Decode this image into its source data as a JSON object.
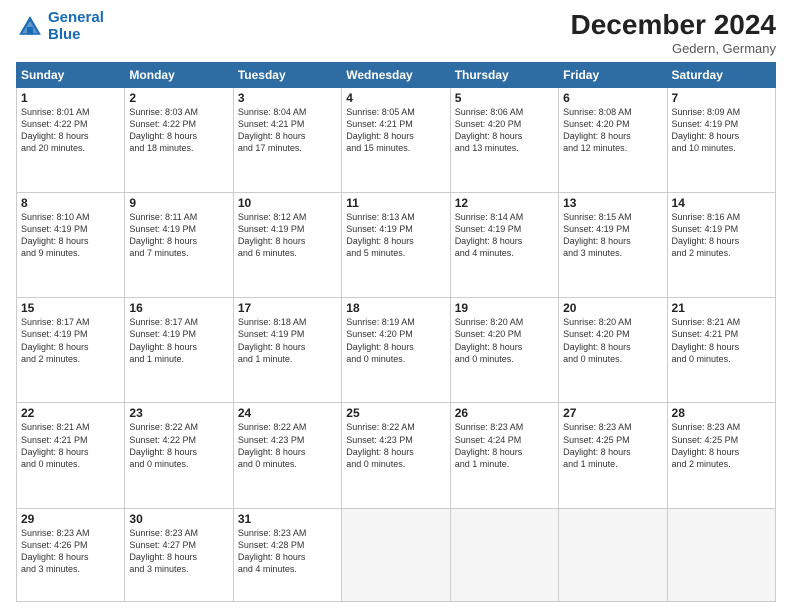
{
  "header": {
    "logo_line1": "General",
    "logo_line2": "Blue",
    "month": "December 2024",
    "location": "Gedern, Germany"
  },
  "weekdays": [
    "Sunday",
    "Monday",
    "Tuesday",
    "Wednesday",
    "Thursday",
    "Friday",
    "Saturday"
  ],
  "weeks": [
    [
      {
        "day": "1",
        "text": "Sunrise: 8:01 AM\nSunset: 4:22 PM\nDaylight: 8 hours\nand 20 minutes."
      },
      {
        "day": "2",
        "text": "Sunrise: 8:03 AM\nSunset: 4:22 PM\nDaylight: 8 hours\nand 18 minutes."
      },
      {
        "day": "3",
        "text": "Sunrise: 8:04 AM\nSunset: 4:21 PM\nDaylight: 8 hours\nand 17 minutes."
      },
      {
        "day": "4",
        "text": "Sunrise: 8:05 AM\nSunset: 4:21 PM\nDaylight: 8 hours\nand 15 minutes."
      },
      {
        "day": "5",
        "text": "Sunrise: 8:06 AM\nSunset: 4:20 PM\nDaylight: 8 hours\nand 13 minutes."
      },
      {
        "day": "6",
        "text": "Sunrise: 8:08 AM\nSunset: 4:20 PM\nDaylight: 8 hours\nand 12 minutes."
      },
      {
        "day": "7",
        "text": "Sunrise: 8:09 AM\nSunset: 4:19 PM\nDaylight: 8 hours\nand 10 minutes."
      }
    ],
    [
      {
        "day": "8",
        "text": "Sunrise: 8:10 AM\nSunset: 4:19 PM\nDaylight: 8 hours\nand 9 minutes."
      },
      {
        "day": "9",
        "text": "Sunrise: 8:11 AM\nSunset: 4:19 PM\nDaylight: 8 hours\nand 7 minutes."
      },
      {
        "day": "10",
        "text": "Sunrise: 8:12 AM\nSunset: 4:19 PM\nDaylight: 8 hours\nand 6 minutes."
      },
      {
        "day": "11",
        "text": "Sunrise: 8:13 AM\nSunset: 4:19 PM\nDaylight: 8 hours\nand 5 minutes."
      },
      {
        "day": "12",
        "text": "Sunrise: 8:14 AM\nSunset: 4:19 PM\nDaylight: 8 hours\nand 4 minutes."
      },
      {
        "day": "13",
        "text": "Sunrise: 8:15 AM\nSunset: 4:19 PM\nDaylight: 8 hours\nand 3 minutes."
      },
      {
        "day": "14",
        "text": "Sunrise: 8:16 AM\nSunset: 4:19 PM\nDaylight: 8 hours\nand 2 minutes."
      }
    ],
    [
      {
        "day": "15",
        "text": "Sunrise: 8:17 AM\nSunset: 4:19 PM\nDaylight: 8 hours\nand 2 minutes."
      },
      {
        "day": "16",
        "text": "Sunrise: 8:17 AM\nSunset: 4:19 PM\nDaylight: 8 hours\nand 1 minute."
      },
      {
        "day": "17",
        "text": "Sunrise: 8:18 AM\nSunset: 4:19 PM\nDaylight: 8 hours\nand 1 minute."
      },
      {
        "day": "18",
        "text": "Sunrise: 8:19 AM\nSunset: 4:20 PM\nDaylight: 8 hours\nand 0 minutes."
      },
      {
        "day": "19",
        "text": "Sunrise: 8:20 AM\nSunset: 4:20 PM\nDaylight: 8 hours\nand 0 minutes."
      },
      {
        "day": "20",
        "text": "Sunrise: 8:20 AM\nSunset: 4:20 PM\nDaylight: 8 hours\nand 0 minutes."
      },
      {
        "day": "21",
        "text": "Sunrise: 8:21 AM\nSunset: 4:21 PM\nDaylight: 8 hours\nand 0 minutes."
      }
    ],
    [
      {
        "day": "22",
        "text": "Sunrise: 8:21 AM\nSunset: 4:21 PM\nDaylight: 8 hours\nand 0 minutes."
      },
      {
        "day": "23",
        "text": "Sunrise: 8:22 AM\nSunset: 4:22 PM\nDaylight: 8 hours\nand 0 minutes."
      },
      {
        "day": "24",
        "text": "Sunrise: 8:22 AM\nSunset: 4:23 PM\nDaylight: 8 hours\nand 0 minutes."
      },
      {
        "day": "25",
        "text": "Sunrise: 8:22 AM\nSunset: 4:23 PM\nDaylight: 8 hours\nand 0 minutes."
      },
      {
        "day": "26",
        "text": "Sunrise: 8:23 AM\nSunset: 4:24 PM\nDaylight: 8 hours\nand 1 minute."
      },
      {
        "day": "27",
        "text": "Sunrise: 8:23 AM\nSunset: 4:25 PM\nDaylight: 8 hours\nand 1 minute."
      },
      {
        "day": "28",
        "text": "Sunrise: 8:23 AM\nSunset: 4:25 PM\nDaylight: 8 hours\nand 2 minutes."
      }
    ],
    [
      {
        "day": "29",
        "text": "Sunrise: 8:23 AM\nSunset: 4:26 PM\nDaylight: 8 hours\nand 3 minutes."
      },
      {
        "day": "30",
        "text": "Sunrise: 8:23 AM\nSunset: 4:27 PM\nDaylight: 8 hours\nand 3 minutes."
      },
      {
        "day": "31",
        "text": "Sunrise: 8:23 AM\nSunset: 4:28 PM\nDaylight: 8 hours\nand 4 minutes."
      },
      null,
      null,
      null,
      null
    ]
  ]
}
